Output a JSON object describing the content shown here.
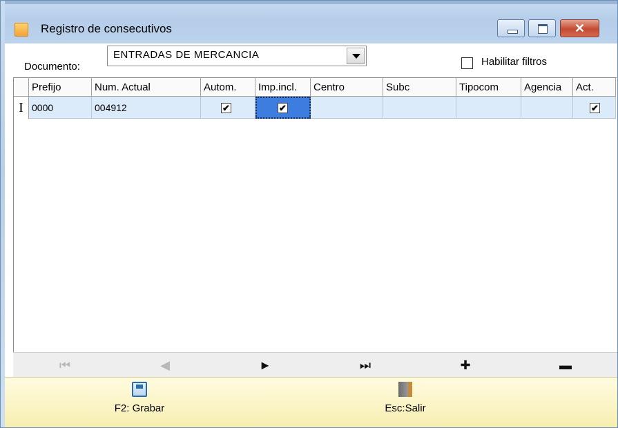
{
  "window": {
    "title": "Registro de consecutivos",
    "controls": [
      "minimize-icon",
      "maximize-icon",
      "close-icon"
    ]
  },
  "toolbar": {
    "document_label": "Documento:",
    "document_value": "ENTRADAS DE MERCANCIA",
    "filter_label": "Habilitar filtros",
    "filter_checked": false
  },
  "grid": {
    "columns": [
      "Prefijo",
      "Num. Actual",
      "Autom.",
      "Imp.incl.",
      "Centro",
      "Subc",
      "Tipocom",
      "Agencia",
      "Act."
    ],
    "rows": [
      {
        "prefijo": "0000",
        "num_actual": "004912",
        "autom": true,
        "imp_incl": true,
        "centro": "",
        "subc": "",
        "tipocom": "",
        "agencia": "",
        "act": true
      }
    ],
    "check_glyph": "✔",
    "row_indicator": "I"
  },
  "navigator": {
    "first": "⏮",
    "prev": "◀",
    "next": "►",
    "last": "⏭",
    "add": "✚",
    "delete": "▬"
  },
  "footer": {
    "save_label": "F2: Grabar",
    "exit_label": "Esc:Salir"
  }
}
